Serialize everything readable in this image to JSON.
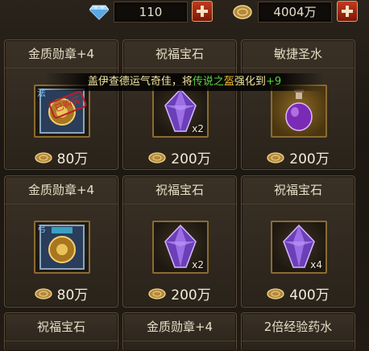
{
  "currency": {
    "diamond_icon": "diamond-icon",
    "diamond_value": "110",
    "gold_icon": "gold-coin-icon",
    "gold_value": "4004万"
  },
  "banner": {
    "part1": "盖伊查德运气奇佳，将",
    "part2": "传说之",
    "part3": "盔",
    "part4": "强化到",
    "part5": "+9"
  },
  "shop": {
    "items": [
      {
        "title": "金质勋章+4",
        "price": "80万",
        "qty": "",
        "badge": "已购买",
        "tag": "法",
        "icon": "medal-icon"
      },
      {
        "title": "祝福宝石",
        "price": "200万",
        "qty": "x2",
        "icon": "crystal-icon"
      },
      {
        "title": "敏捷圣水",
        "price": "200万",
        "qty": "",
        "icon": "potion-icon"
      },
      {
        "title": "金质勋章+4",
        "price": "80万",
        "qty": "",
        "tag": "弓",
        "icon": "medal-icon"
      },
      {
        "title": "祝福宝石",
        "price": "200万",
        "qty": "x2",
        "icon": "crystal-icon"
      },
      {
        "title": "祝福宝石",
        "price": "400万",
        "qty": "x4",
        "icon": "crystal-icon"
      },
      {
        "title": "祝福宝石",
        "icon": "crystal-icon"
      },
      {
        "title": "金质勋章+4",
        "icon": "medal-icon"
      },
      {
        "title": "2倍经验药水",
        "icon": "potion-icon"
      }
    ]
  }
}
